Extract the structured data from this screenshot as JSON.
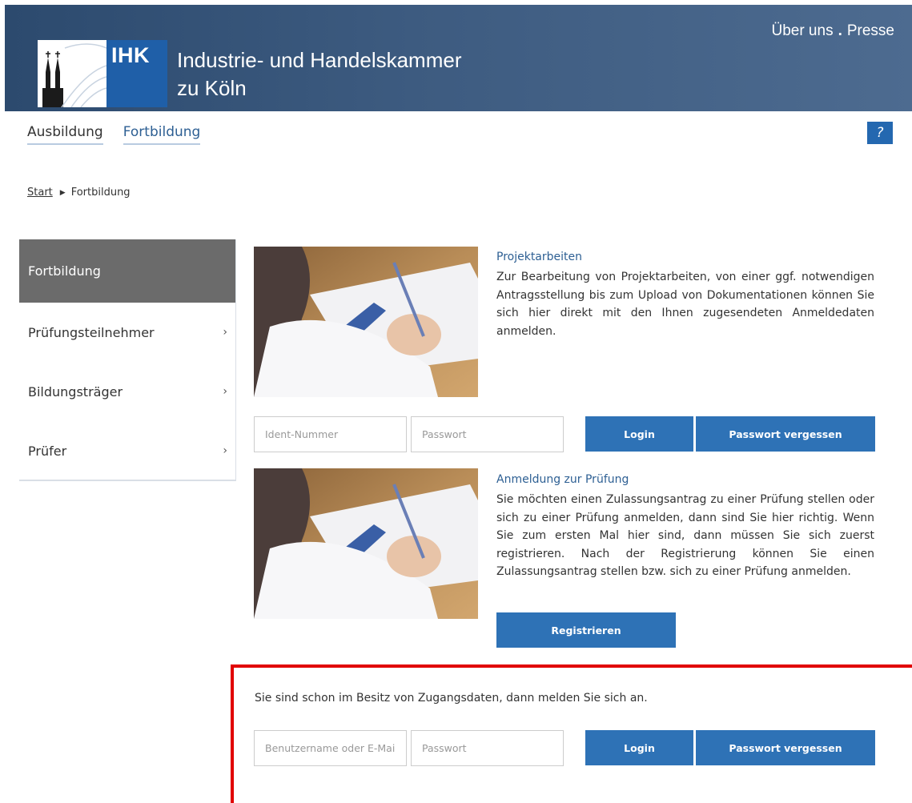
{
  "header": {
    "logo_text": "IHK",
    "title_line1": "Industrie- und Handelskammer",
    "title_line2": "zu Köln",
    "links": [
      "Über uns",
      "Presse"
    ],
    "link_separator": "."
  },
  "main_nav": {
    "items": [
      "Ausbildung",
      "Fortbildung"
    ],
    "help_label": "?"
  },
  "breadcrumb": {
    "start": "Start",
    "current": "Fortbildung"
  },
  "sidebar": {
    "items": [
      {
        "label": "Fortbildung",
        "active": true,
        "chevron": ""
      },
      {
        "label": "Prüfungsteilnehmer",
        "active": false,
        "chevron": "›"
      },
      {
        "label": "Bildungsträger",
        "active": false,
        "chevron": "›"
      },
      {
        "label": "Prüfer",
        "active": false,
        "chevron": "›"
      }
    ]
  },
  "projektarbeiten": {
    "title": "Projektarbeiten",
    "body": "Zur Bearbeitung von Projektarbeiten, von einer ggf. notwendigen Antragsstellung bis zum Upload von Dokumentationen können Sie sich hier direkt mit den Ihnen zugesendeten Anmeldedaten anmelden.",
    "ident_placeholder": "Ident-Nummer",
    "password_placeholder": "Passwort",
    "login_label": "Login",
    "forgot_label": "Passwort vergessen"
  },
  "anmeldung": {
    "title": "Anmeldung zur Prüfung",
    "body": "Sie möchten einen Zulassungsantrag zu einer Prüfung stellen oder sich zu einer Prüfung anmelden, dann sind Sie hier richtig. Wenn Sie zum ersten Mal hier sind, dann müssen Sie sich zuerst registrieren. Nach der Registrierung können Sie einen Zulassungsantrag stellen bzw. sich zu einer Prüfung anmelden.",
    "register_label": "Registrieren"
  },
  "account_login": {
    "info": "Sie sind schon im Besitz von Zugangsdaten, dann melden Sie sich an.",
    "user_placeholder": "Benutzername oder E-Mail",
    "password_placeholder": "Passwort",
    "login_label": "Login",
    "forgot_label": "Passwort vergessen"
  },
  "colors": {
    "header": "#3d5b80",
    "primary_button": "#2e72b6",
    "link": "#2d5f93",
    "sidebar_active": "#6b6b6b",
    "highlight": "#e10000"
  }
}
